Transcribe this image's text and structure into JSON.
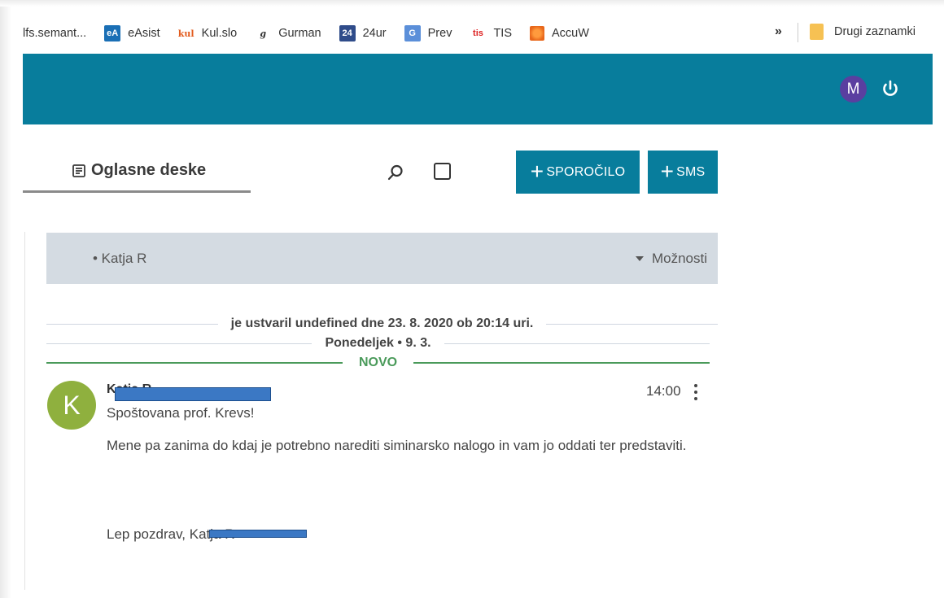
{
  "bookmarks": {
    "items": [
      {
        "label": "lfs.semant...",
        "icon": "none"
      },
      {
        "label": "eAsist",
        "icon": "easist-icon",
        "glyph": "eA"
      },
      {
        "label": "Kul.slo",
        "icon": "kulslo-icon",
        "glyph": "kul"
      },
      {
        "label": "Gurman",
        "icon": "gurman-icon",
        "glyph": "g"
      },
      {
        "label": "24ur",
        "icon": "24ur-icon",
        "glyph": "24"
      },
      {
        "label": "Prev",
        "icon": "translate-icon",
        "glyph": "G"
      },
      {
        "label": "TIS",
        "icon": "tis-icon",
        "glyph": "tis"
      },
      {
        "label": "AccuW",
        "icon": "accuweather-icon",
        "glyph": ""
      }
    ],
    "more": "»",
    "other_folder": "Drugi zaznamki"
  },
  "header": {
    "user_initial": "M",
    "accent_color": "#087d9c"
  },
  "toolbar": {
    "tab_title": "Oglasne deske",
    "new_message_label": "SPOROČILO",
    "new_sms_label": "SMS",
    "plus": "+"
  },
  "board": {
    "author_tag": "• Katja R",
    "options_label": "Možnosti",
    "created_text": "je ustvaril undefined dne 23. 8. 2020 ob 20:14 uri.",
    "date_divider": "Ponedeljek • 9. 3.",
    "new_divider": "NOVO"
  },
  "message": {
    "avatar_initial": "K",
    "author": "Katja R",
    "time": "14:00",
    "greeting": "Spoštovana prof. Krevs!",
    "body": "Mene pa zanima do kdaj je potrebno narediti siminarsko nalogo in vam jo oddati ter predstaviti.",
    "signoff": "Lep pozdrav, Katja R"
  }
}
